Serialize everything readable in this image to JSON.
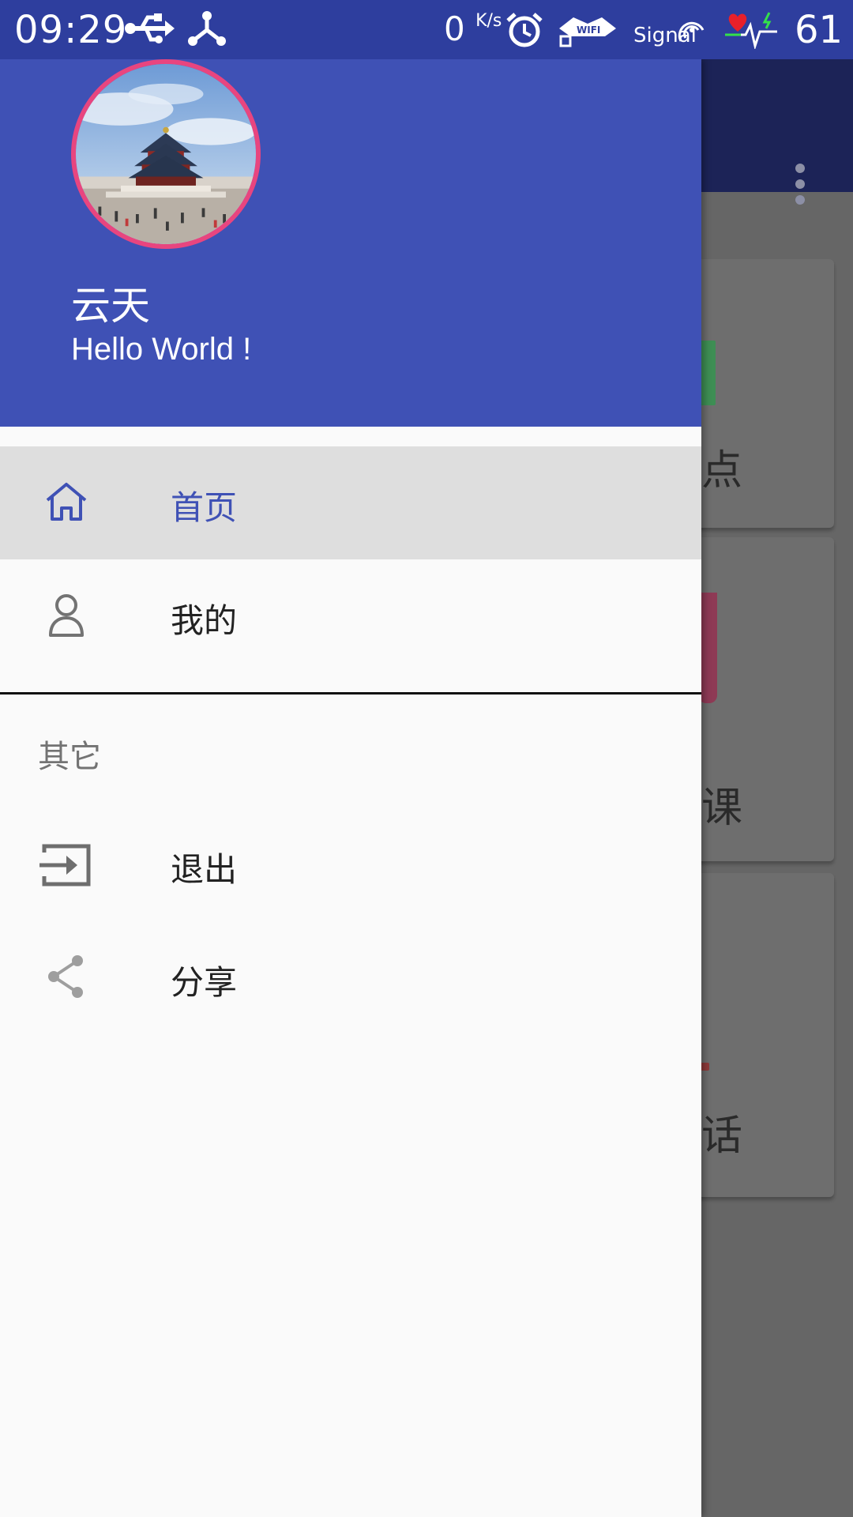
{
  "status_bar": {
    "time": "09:29",
    "net_speed": "0",
    "net_speed_unit": "K/s",
    "wifi_label": "WIFI",
    "signal_label": "Signal",
    "battery": "61",
    "icons": [
      "usb-icon",
      "share-network-icon",
      "alarm-icon",
      "wifi-icon",
      "signal-icon",
      "heart-rate-icon"
    ]
  },
  "background": {
    "card_texts": [
      "点",
      "课",
      "话"
    ]
  },
  "drawer": {
    "header": {
      "user_name": "云天",
      "user_subtitle": "Hello World !",
      "header_color": "#3F51B5",
      "avatar_border_color": "#E8457F"
    },
    "items": [
      {
        "label": "首页",
        "icon": "home-icon",
        "selected": true
      },
      {
        "label": "我的",
        "icon": "person-icon",
        "selected": false
      }
    ],
    "section_title": "其它",
    "other_items": [
      {
        "label": "退出",
        "icon": "exit-icon"
      },
      {
        "label": "分享",
        "icon": "share-icon"
      }
    ]
  }
}
